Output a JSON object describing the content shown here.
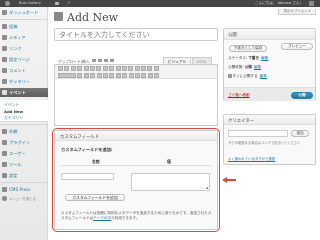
{
  "admin_bar": {
    "site_name": "Rust Gallery",
    "greeting": "こんにちは、 takuma さん！"
  },
  "sidebar": {
    "items": [
      {
        "label": "ダッシュボード",
        "icon": "dashboard-icon"
      },
      {
        "label": "投稿",
        "icon": "pin-icon"
      },
      {
        "label": "メディア",
        "icon": "media-icon"
      },
      {
        "label": "リンク",
        "icon": "link-icon"
      },
      {
        "label": "固定ページ",
        "icon": "page-icon"
      },
      {
        "label": "コメント",
        "icon": "comment-icon"
      },
      {
        "label": "ギャラリー",
        "icon": "gallery-icon"
      },
      {
        "label": "イベント",
        "icon": "event-icon"
      },
      {
        "label": "外観",
        "icon": "appearance-icon"
      },
      {
        "label": "プラグイン",
        "icon": "plugin-icon"
      },
      {
        "label": "ユーザー",
        "icon": "users-icon"
      },
      {
        "label": "ツール",
        "icon": "tools-icon"
      },
      {
        "label": "設定",
        "icon": "settings-icon"
      },
      {
        "label": "CMS Press",
        "icon": "cms-press-icon"
      }
    ],
    "submenu": [
      "イベント",
      "Add New",
      "カテゴリー"
    ],
    "collapse_label": "メニューを閉じる"
  },
  "screen_options": "表示オプション ▾",
  "page": {
    "title": "Add New",
    "title_placeholder": "タイトルを入力してください"
  },
  "editor": {
    "upload_label": "アップロード/挿入",
    "tab_visual": "ビジュアル",
    "tab_html": "HTML",
    "path_label": "パス: p",
    "word_count": "文字数: 0"
  },
  "custom_fields": {
    "heading": "カスタムフィールド",
    "subheading": "カスタムフィールドを追加:",
    "col_name": "名前",
    "col_value": "値",
    "add_button": "カスタムフィールドを追加",
    "note_before": "カスタムフィールドは投稿に特別なメタデータを追加するために使うものです。追加されたカスタムフィールドは",
    "note_link": "テーマの中",
    "note_after": "で利用できます。"
  },
  "publish": {
    "heading": "公開",
    "save_draft": "下書きとして保存",
    "preview": "プレビュー",
    "status_label": "ステータス:",
    "status_value": "下書き",
    "status_edit": "編集",
    "visibility_label": "公開状態:",
    "visibility_value": "公開",
    "visibility_edit": "編集",
    "schedule_label": "すぐに公開する",
    "schedule_edit": "編集",
    "trash": "ゴミ箱へ移動",
    "publish_button": "公開"
  },
  "category": {
    "heading": "クリエイター",
    "add_button": "追加",
    "help": "タグが複数ある場合はコンマで区切ってください",
    "link": "よく使われているタグから選択"
  },
  "colors": {
    "highlight": "#d44c3c",
    "link": "#21759b",
    "admin_bar": "#464646"
  }
}
